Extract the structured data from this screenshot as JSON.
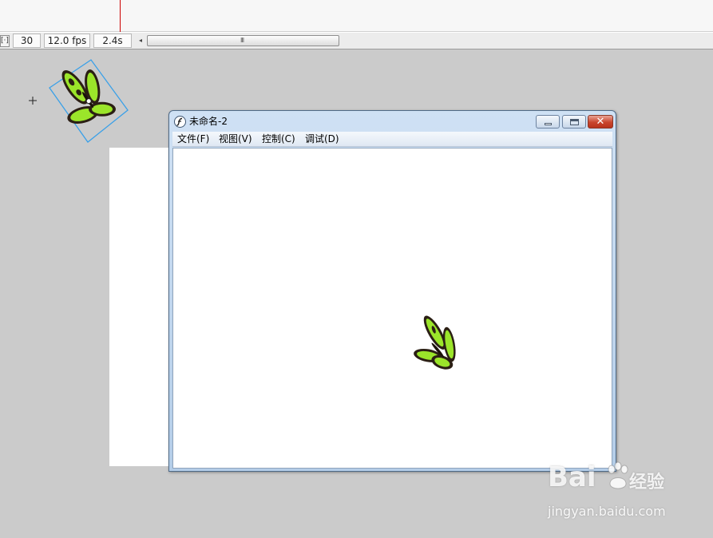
{
  "timeline": {
    "frame": "30",
    "fps": "12.0 fps",
    "time": "2.4s",
    "scroll_grip": "III",
    "scroll_left_arrow": "◂",
    "fit_button_glyph": "[·]"
  },
  "stage": {
    "crosshair_icon": "crosshair-icon",
    "butterfly_color": "#9be52a",
    "butterfly_outline": "#2b1f14",
    "selection_color": "#3aa0e8"
  },
  "player_window": {
    "title": "未命名-2",
    "icon": "flash-player-icon",
    "menu": [
      "文件(F)",
      "视图(V)",
      "控制(C)",
      "调试(D)"
    ],
    "close_glyph": "✕"
  },
  "watermark": {
    "logo": "Bai",
    "logo_cn": "经验",
    "url": "jingyan.baidu.com"
  },
  "colors": {
    "workspace_bg": "#cbcbcb",
    "window_frame": "#b4cde8",
    "close_button": "#c9452d"
  }
}
